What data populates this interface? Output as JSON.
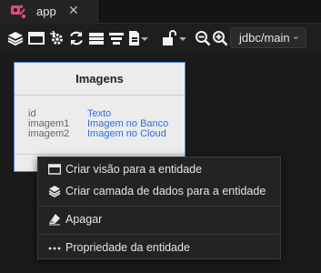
{
  "tabs": [
    {
      "label": "app",
      "close": "✕",
      "icon": "app-logo-icon"
    }
  ],
  "toolbar": {
    "icons": [
      "layers-icon",
      "window-icon",
      "gear-arrow-icon",
      "refresh-icon",
      "stack-icon",
      "align-icon",
      "document-add-icon",
      "chevron-down-icon",
      "unlock-icon",
      "chevron-down-icon",
      "zoom-out-icon",
      "zoom-in-icon"
    ],
    "connection": {
      "value": "jdbc/main",
      "icon": "chevron-down-icon"
    }
  },
  "entity": {
    "title": "Imagens",
    "fields": [
      {
        "name": "id",
        "type": "Texto"
      },
      {
        "name": "imagem1",
        "type": "Imagem no Banco"
      },
      {
        "name": "imagem2",
        "type": "Imagem no Cloud"
      }
    ]
  },
  "context_menu": {
    "items": [
      {
        "label": "Criar visão para a entidade",
        "icon": "window-icon"
      },
      {
        "label": "Criar camada de dados para a entidade",
        "icon": "layers-icon"
      },
      {
        "label": "Apagar",
        "icon": "eraser-icon"
      },
      {
        "label": "Propriedade da entidade",
        "icon": "ellipsis-icon"
      }
    ]
  },
  "colors": {
    "background": "#1b1b1b",
    "accent_blue": "#2b6de0",
    "entity_border": "#4b86d8",
    "app_icon": "#e8477a"
  }
}
